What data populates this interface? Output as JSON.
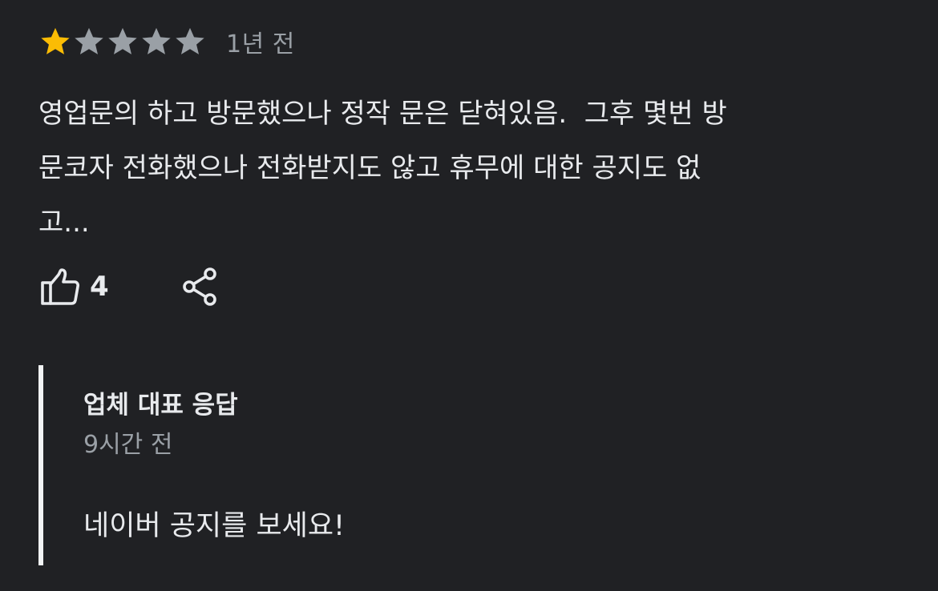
{
  "review": {
    "rating": 1,
    "max_rating": 5,
    "star_filled_color": "#fbbc04",
    "star_empty_color": "#9aa0a6",
    "time_ago": "1년 전",
    "text": "영업문의 하고 방문했으나 정작 문은 닫혀있음.  그후 몇번 방\n문코자 전화했으나 전화받지도 않고 휴무에 대한 공지도 없\n고..."
  },
  "actions": {
    "like_icon": "thumbs-up-icon",
    "like_count": "4",
    "share_icon": "share-icon"
  },
  "owner_response": {
    "title": "업체 대표 응답",
    "time_ago": "9시간 전",
    "text": "네이버 공지를 보세요!"
  }
}
